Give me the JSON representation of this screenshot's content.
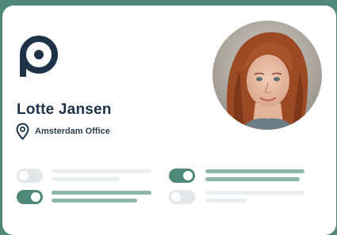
{
  "profile": {
    "name": "Lotte Jansen",
    "location": "Amsterdam Office"
  },
  "icons": {
    "brand": "brand-logo-icon",
    "location": "location-pin-icon"
  },
  "colors": {
    "brand_navy": "#1f3348",
    "accent_green": "#4f8779",
    "muted_green": "#8fb7aa",
    "toggle_off": "#e3e7e9",
    "placeholder_grey": "#eceff1"
  },
  "settings": [
    {
      "enabled": false
    },
    {
      "enabled": true
    },
    {
      "enabled": true
    },
    {
      "enabled": false
    }
  ]
}
